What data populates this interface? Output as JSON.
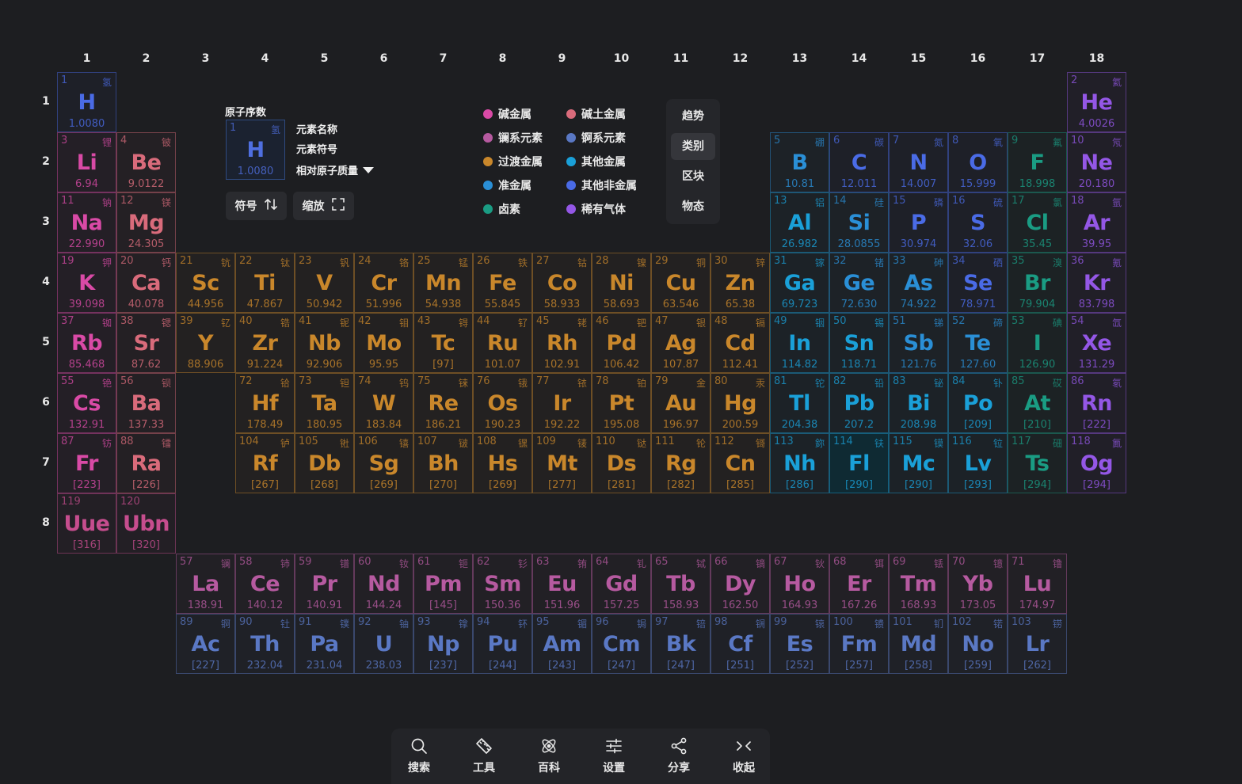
{
  "groups": [
    "1",
    "2",
    "3",
    "4",
    "5",
    "6",
    "7",
    "8",
    "9",
    "10",
    "11",
    "12",
    "13",
    "14",
    "15",
    "16",
    "17",
    "18"
  ],
  "periods": [
    "1",
    "2",
    "3",
    "4",
    "5",
    "6",
    "7",
    "8"
  ],
  "colors": {
    "alkali": "#d94aa6",
    "alkaline_earth": "#d96b7b",
    "lanthanide": "#b65aa0",
    "actinide": "#5a78c4",
    "transition": "#c9872b",
    "post_transition": "#1aa0d8",
    "metalloid": "#2a8fd6",
    "halogen": "#1a9c83",
    "nonmetal": "#4a6be6",
    "noble": "#9457e6",
    "unknown": "#c64d8e"
  },
  "key": {
    "atomic_number_label": "原子序数",
    "name_label": "元素名称",
    "symbol_label": "元素符号",
    "mass_label": "相对原子质量",
    "sample": {
      "num": "1",
      "cn": "氢",
      "sym": "H",
      "mass": "1.0080"
    }
  },
  "buttons": {
    "symbol": "符号",
    "zoom": "缩放"
  },
  "legend": [
    {
      "label": "碱金属",
      "color": "#d94aa6"
    },
    {
      "label": "碱土金属",
      "color": "#d96b7b"
    },
    {
      "label": "镧系元素",
      "color": "#b65aa0"
    },
    {
      "label": "锕系元素",
      "color": "#5a78c4"
    },
    {
      "label": "过渡金属",
      "color": "#c9872b"
    },
    {
      "label": "其他金属",
      "color": "#1aa0d8"
    },
    {
      "label": "准金属",
      "color": "#2a8fd6"
    },
    {
      "label": "其他非金属",
      "color": "#4a6be6"
    },
    {
      "label": "卤素",
      "color": "#1a9c83"
    },
    {
      "label": "稀有气体",
      "color": "#9457e6"
    }
  ],
  "modes": [
    {
      "label": "趋势",
      "active": false
    },
    {
      "label": "类别",
      "active": true
    },
    {
      "label": "区块",
      "active": false
    },
    {
      "label": "物态",
      "active": false
    }
  ],
  "toolbar": [
    {
      "label": "搜索",
      "icon": "search-icon"
    },
    {
      "label": "工具",
      "icon": "ruler-icon"
    },
    {
      "label": "百科",
      "icon": "atom-icon"
    },
    {
      "label": "设置",
      "icon": "sliders-icon"
    },
    {
      "label": "分享",
      "icon": "share-icon"
    },
    {
      "label": "收起",
      "icon": "collapse-icon"
    }
  ],
  "elements": [
    {
      "n": "1",
      "cn": "氢",
      "s": "H",
      "m": "1.0080",
      "g": 1,
      "p": 1,
      "c": "nonmetal"
    },
    {
      "n": "2",
      "cn": "氦",
      "s": "He",
      "m": "4.0026",
      "g": 18,
      "p": 1,
      "c": "noble"
    },
    {
      "n": "3",
      "cn": "锂",
      "s": "Li",
      "m": "6.94",
      "g": 1,
      "p": 2,
      "c": "alkali"
    },
    {
      "n": "4",
      "cn": "铍",
      "s": "Be",
      "m": "9.0122",
      "g": 2,
      "p": 2,
      "c": "alkaline_earth"
    },
    {
      "n": "5",
      "cn": "硼",
      "s": "B",
      "m": "10.81",
      "g": 13,
      "p": 2,
      "c": "metalloid"
    },
    {
      "n": "6",
      "cn": "碳",
      "s": "C",
      "m": "12.011",
      "g": 14,
      "p": 2,
      "c": "nonmetal"
    },
    {
      "n": "7",
      "cn": "氮",
      "s": "N",
      "m": "14.007",
      "g": 15,
      "p": 2,
      "c": "nonmetal"
    },
    {
      "n": "8",
      "cn": "氧",
      "s": "O",
      "m": "15.999",
      "g": 16,
      "p": 2,
      "c": "nonmetal"
    },
    {
      "n": "9",
      "cn": "氟",
      "s": "F",
      "m": "18.998",
      "g": 17,
      "p": 2,
      "c": "halogen"
    },
    {
      "n": "10",
      "cn": "氖",
      "s": "Ne",
      "m": "20.180",
      "g": 18,
      "p": 2,
      "c": "noble"
    },
    {
      "n": "11",
      "cn": "钠",
      "s": "Na",
      "m": "22.990",
      "g": 1,
      "p": 3,
      "c": "alkali"
    },
    {
      "n": "12",
      "cn": "镁",
      "s": "Mg",
      "m": "24.305",
      "g": 2,
      "p": 3,
      "c": "alkaline_earth"
    },
    {
      "n": "13",
      "cn": "铝",
      "s": "Al",
      "m": "26.982",
      "g": 13,
      "p": 3,
      "c": "post_transition"
    },
    {
      "n": "14",
      "cn": "硅",
      "s": "Si",
      "m": "28.0855",
      "g": 14,
      "p": 3,
      "c": "metalloid"
    },
    {
      "n": "15",
      "cn": "磷",
      "s": "P",
      "m": "30.974",
      "g": 15,
      "p": 3,
      "c": "nonmetal"
    },
    {
      "n": "16",
      "cn": "硫",
      "s": "S",
      "m": "32.06",
      "g": 16,
      "p": 3,
      "c": "nonmetal"
    },
    {
      "n": "17",
      "cn": "氯",
      "s": "Cl",
      "m": "35.45",
      "g": 17,
      "p": 3,
      "c": "halogen"
    },
    {
      "n": "18",
      "cn": "氩",
      "s": "Ar",
      "m": "39.95",
      "g": 18,
      "p": 3,
      "c": "noble"
    },
    {
      "n": "19",
      "cn": "钾",
      "s": "K",
      "m": "39.098",
      "g": 1,
      "p": 4,
      "c": "alkali"
    },
    {
      "n": "20",
      "cn": "钙",
      "s": "Ca",
      "m": "40.078",
      "g": 2,
      "p": 4,
      "c": "alkaline_earth"
    },
    {
      "n": "21",
      "cn": "钪",
      "s": "Sc",
      "m": "44.956",
      "g": 3,
      "p": 4,
      "c": "transition"
    },
    {
      "n": "22",
      "cn": "钛",
      "s": "Ti",
      "m": "47.867",
      "g": 4,
      "p": 4,
      "c": "transition"
    },
    {
      "n": "23",
      "cn": "钒",
      "s": "V",
      "m": "50.942",
      "g": 5,
      "p": 4,
      "c": "transition"
    },
    {
      "n": "24",
      "cn": "铬",
      "s": "Cr",
      "m": "51.996",
      "g": 6,
      "p": 4,
      "c": "transition"
    },
    {
      "n": "25",
      "cn": "锰",
      "s": "Mn",
      "m": "54.938",
      "g": 7,
      "p": 4,
      "c": "transition"
    },
    {
      "n": "26",
      "cn": "铁",
      "s": "Fe",
      "m": "55.845",
      "g": 8,
      "p": 4,
      "c": "transition"
    },
    {
      "n": "27",
      "cn": "钴",
      "s": "Co",
      "m": "58.933",
      "g": 9,
      "p": 4,
      "c": "transition"
    },
    {
      "n": "28",
      "cn": "镍",
      "s": "Ni",
      "m": "58.693",
      "g": 10,
      "p": 4,
      "c": "transition"
    },
    {
      "n": "29",
      "cn": "铜",
      "s": "Cu",
      "m": "63.546",
      "g": 11,
      "p": 4,
      "c": "transition"
    },
    {
      "n": "30",
      "cn": "锌",
      "s": "Zn",
      "m": "65.38",
      "g": 12,
      "p": 4,
      "c": "transition"
    },
    {
      "n": "31",
      "cn": "镓",
      "s": "Ga",
      "m": "69.723",
      "g": 13,
      "p": 4,
      "c": "post_transition"
    },
    {
      "n": "32",
      "cn": "锗",
      "s": "Ge",
      "m": "72.630",
      "g": 14,
      "p": 4,
      "c": "metalloid"
    },
    {
      "n": "33",
      "cn": "砷",
      "s": "As",
      "m": "74.922",
      "g": 15,
      "p": 4,
      "c": "metalloid"
    },
    {
      "n": "34",
      "cn": "硒",
      "s": "Se",
      "m": "78.971",
      "g": 16,
      "p": 4,
      "c": "nonmetal"
    },
    {
      "n": "35",
      "cn": "溴",
      "s": "Br",
      "m": "79.904",
      "g": 17,
      "p": 4,
      "c": "halogen"
    },
    {
      "n": "36",
      "cn": "氪",
      "s": "Kr",
      "m": "83.798",
      "g": 18,
      "p": 4,
      "c": "noble"
    },
    {
      "n": "37",
      "cn": "铷",
      "s": "Rb",
      "m": "85.468",
      "g": 1,
      "p": 5,
      "c": "alkali"
    },
    {
      "n": "38",
      "cn": "锶",
      "s": "Sr",
      "m": "87.62",
      "g": 2,
      "p": 5,
      "c": "alkaline_earth"
    },
    {
      "n": "39",
      "cn": "钇",
      "s": "Y",
      "m": "88.906",
      "g": 3,
      "p": 5,
      "c": "transition"
    },
    {
      "n": "40",
      "cn": "锆",
      "s": "Zr",
      "m": "91.224",
      "g": 4,
      "p": 5,
      "c": "transition"
    },
    {
      "n": "41",
      "cn": "铌",
      "s": "Nb",
      "m": "92.906",
      "g": 5,
      "p": 5,
      "c": "transition"
    },
    {
      "n": "42",
      "cn": "钼",
      "s": "Mo",
      "m": "95.95",
      "g": 6,
      "p": 5,
      "c": "transition"
    },
    {
      "n": "43",
      "cn": "锝",
      "s": "Tc",
      "m": "[97]",
      "g": 7,
      "p": 5,
      "c": "transition"
    },
    {
      "n": "44",
      "cn": "钌",
      "s": "Ru",
      "m": "101.07",
      "g": 8,
      "p": 5,
      "c": "transition"
    },
    {
      "n": "45",
      "cn": "铑",
      "s": "Rh",
      "m": "102.91",
      "g": 9,
      "p": 5,
      "c": "transition"
    },
    {
      "n": "46",
      "cn": "钯",
      "s": "Pd",
      "m": "106.42",
      "g": 10,
      "p": 5,
      "c": "transition"
    },
    {
      "n": "47",
      "cn": "银",
      "s": "Ag",
      "m": "107.87",
      "g": 11,
      "p": 5,
      "c": "transition"
    },
    {
      "n": "48",
      "cn": "镉",
      "s": "Cd",
      "m": "112.41",
      "g": 12,
      "p": 5,
      "c": "transition"
    },
    {
      "n": "49",
      "cn": "铟",
      "s": "In",
      "m": "114.82",
      "g": 13,
      "p": 5,
      "c": "post_transition"
    },
    {
      "n": "50",
      "cn": "锡",
      "s": "Sn",
      "m": "118.71",
      "g": 14,
      "p": 5,
      "c": "post_transition"
    },
    {
      "n": "51",
      "cn": "锑",
      "s": "Sb",
      "m": "121.76",
      "g": 15,
      "p": 5,
      "c": "metalloid"
    },
    {
      "n": "52",
      "cn": "碲",
      "s": "Te",
      "m": "127.60",
      "g": 16,
      "p": 5,
      "c": "metalloid"
    },
    {
      "n": "53",
      "cn": "碘",
      "s": "I",
      "m": "126.90",
      "g": 17,
      "p": 5,
      "c": "halogen"
    },
    {
      "n": "54",
      "cn": "氙",
      "s": "Xe",
      "m": "131.29",
      "g": 18,
      "p": 5,
      "c": "noble"
    },
    {
      "n": "55",
      "cn": "铯",
      "s": "Cs",
      "m": "132.91",
      "g": 1,
      "p": 6,
      "c": "alkali"
    },
    {
      "n": "56",
      "cn": "钡",
      "s": "Ba",
      "m": "137.33",
      "g": 2,
      "p": 6,
      "c": "alkaline_earth"
    },
    {
      "n": "72",
      "cn": "铪",
      "s": "Hf",
      "m": "178.49",
      "g": 4,
      "p": 6,
      "c": "transition"
    },
    {
      "n": "73",
      "cn": "钽",
      "s": "Ta",
      "m": "180.95",
      "g": 5,
      "p": 6,
      "c": "transition"
    },
    {
      "n": "74",
      "cn": "钨",
      "s": "W",
      "m": "183.84",
      "g": 6,
      "p": 6,
      "c": "transition"
    },
    {
      "n": "75",
      "cn": "铼",
      "s": "Re",
      "m": "186.21",
      "g": 7,
      "p": 6,
      "c": "transition"
    },
    {
      "n": "76",
      "cn": "锇",
      "s": "Os",
      "m": "190.23",
      "g": 8,
      "p": 6,
      "c": "transition"
    },
    {
      "n": "77",
      "cn": "铱",
      "s": "Ir",
      "m": "192.22",
      "g": 9,
      "p": 6,
      "c": "transition"
    },
    {
      "n": "78",
      "cn": "铂",
      "s": "Pt",
      "m": "195.08",
      "g": 10,
      "p": 6,
      "c": "transition"
    },
    {
      "n": "79",
      "cn": "金",
      "s": "Au",
      "m": "196.97",
      "g": 11,
      "p": 6,
      "c": "transition"
    },
    {
      "n": "80",
      "cn": "汞",
      "s": "Hg",
      "m": "200.59",
      "g": 12,
      "p": 6,
      "c": "transition"
    },
    {
      "n": "81",
      "cn": "铊",
      "s": "Tl",
      "m": "204.38",
      "g": 13,
      "p": 6,
      "c": "post_transition"
    },
    {
      "n": "82",
      "cn": "铅",
      "s": "Pb",
      "m": "207.2",
      "g": 14,
      "p": 6,
      "c": "post_transition"
    },
    {
      "n": "83",
      "cn": "铋",
      "s": "Bi",
      "m": "208.98",
      "g": 15,
      "p": 6,
      "c": "post_transition"
    },
    {
      "n": "84",
      "cn": "钋",
      "s": "Po",
      "m": "[209]",
      "g": 16,
      "p": 6,
      "c": "post_transition"
    },
    {
      "n": "85",
      "cn": "砹",
      "s": "At",
      "m": "[210]",
      "g": 17,
      "p": 6,
      "c": "halogen"
    },
    {
      "n": "86",
      "cn": "氡",
      "s": "Rn",
      "m": "[222]",
      "g": 18,
      "p": 6,
      "c": "noble"
    },
    {
      "n": "87",
      "cn": "钫",
      "s": "Fr",
      "m": "[223]",
      "g": 1,
      "p": 7,
      "c": "alkali"
    },
    {
      "n": "88",
      "cn": "镭",
      "s": "Ra",
      "m": "[226]",
      "g": 2,
      "p": 7,
      "c": "alkaline_earth"
    },
    {
      "n": "104",
      "cn": "𬬻",
      "s": "Rf",
      "m": "[267]",
      "g": 4,
      "p": 7,
      "c": "transition"
    },
    {
      "n": "105",
      "cn": "𬭊",
      "s": "Db",
      "m": "[268]",
      "g": 5,
      "p": 7,
      "c": "transition"
    },
    {
      "n": "106",
      "cn": "𬭳",
      "s": "Sg",
      "m": "[269]",
      "g": 6,
      "p": 7,
      "c": "transition"
    },
    {
      "n": "107",
      "cn": "𬭛",
      "s": "Bh",
      "m": "[270]",
      "g": 7,
      "p": 7,
      "c": "transition"
    },
    {
      "n": "108",
      "cn": "𬭶",
      "s": "Hs",
      "m": "[269]",
      "g": 8,
      "p": 7,
      "c": "transition"
    },
    {
      "n": "109",
      "cn": "鿏",
      "s": "Mt",
      "m": "[277]",
      "g": 9,
      "p": 7,
      "c": "transition"
    },
    {
      "n": "110",
      "cn": "𫟼",
      "s": "Ds",
      "m": "[281]",
      "g": 10,
      "p": 7,
      "c": "transition"
    },
    {
      "n": "111",
      "cn": "𬬭",
      "s": "Rg",
      "m": "[282]",
      "g": 11,
      "p": 7,
      "c": "transition"
    },
    {
      "n": "112",
      "cn": "鿔",
      "s": "Cn",
      "m": "[285]",
      "g": 12,
      "p": 7,
      "c": "transition"
    },
    {
      "n": "113",
      "cn": "鉨",
      "s": "Nh",
      "m": "[286]",
      "g": 13,
      "p": 7,
      "c": "post_transition"
    },
    {
      "n": "114",
      "cn": "𫓧",
      "s": "Fl",
      "m": "[290]",
      "g": 14,
      "p": 7,
      "c": "post_transition",
      "hl": true
    },
    {
      "n": "115",
      "cn": "镆",
      "s": "Mc",
      "m": "[290]",
      "g": 15,
      "p": 7,
      "c": "post_transition"
    },
    {
      "n": "116",
      "cn": "𫟷",
      "s": "Lv",
      "m": "[293]",
      "g": 16,
      "p": 7,
      "c": "post_transition"
    },
    {
      "n": "117",
      "cn": "鿬",
      "s": "Ts",
      "m": "[294]",
      "g": 17,
      "p": 7,
      "c": "halogen"
    },
    {
      "n": "118",
      "cn": "鿫",
      "s": "Og",
      "m": "[294]",
      "g": 18,
      "p": 7,
      "c": "noble"
    },
    {
      "n": "119",
      "cn": "",
      "s": "Uue",
      "m": "[316]",
      "g": 1,
      "p": 8,
      "c": "unknown"
    },
    {
      "n": "120",
      "cn": "",
      "s": "Ubn",
      "m": "[320]",
      "g": 2,
      "p": 8,
      "c": "unknown"
    },
    {
      "n": "57",
      "cn": "镧",
      "s": "La",
      "m": "138.91",
      "g": 3,
      "p": 9,
      "c": "lanthanide"
    },
    {
      "n": "58",
      "cn": "铈",
      "s": "Ce",
      "m": "140.12",
      "g": 4,
      "p": 9,
      "c": "lanthanide"
    },
    {
      "n": "59",
      "cn": "镨",
      "s": "Pr",
      "m": "140.91",
      "g": 5,
      "p": 9,
      "c": "lanthanide"
    },
    {
      "n": "60",
      "cn": "钕",
      "s": "Nd",
      "m": "144.24",
      "g": 6,
      "p": 9,
      "c": "lanthanide"
    },
    {
      "n": "61",
      "cn": "钷",
      "s": "Pm",
      "m": "[145]",
      "g": 7,
      "p": 9,
      "c": "lanthanide"
    },
    {
      "n": "62",
      "cn": "钐",
      "s": "Sm",
      "m": "150.36",
      "g": 8,
      "p": 9,
      "c": "lanthanide"
    },
    {
      "n": "63",
      "cn": "铕",
      "s": "Eu",
      "m": "151.96",
      "g": 9,
      "p": 9,
      "c": "lanthanide"
    },
    {
      "n": "64",
      "cn": "钆",
      "s": "Gd",
      "m": "157.25",
      "g": 10,
      "p": 9,
      "c": "lanthanide"
    },
    {
      "n": "65",
      "cn": "铽",
      "s": "Tb",
      "m": "158.93",
      "g": 11,
      "p": 9,
      "c": "lanthanide"
    },
    {
      "n": "66",
      "cn": "镝",
      "s": "Dy",
      "m": "162.50",
      "g": 12,
      "p": 9,
      "c": "lanthanide"
    },
    {
      "n": "67",
      "cn": "钬",
      "s": "Ho",
      "m": "164.93",
      "g": 13,
      "p": 9,
      "c": "lanthanide"
    },
    {
      "n": "68",
      "cn": "铒",
      "s": "Er",
      "m": "167.26",
      "g": 14,
      "p": 9,
      "c": "lanthanide"
    },
    {
      "n": "69",
      "cn": "铥",
      "s": "Tm",
      "m": "168.93",
      "g": 15,
      "p": 9,
      "c": "lanthanide"
    },
    {
      "n": "70",
      "cn": "镱",
      "s": "Yb",
      "m": "173.05",
      "g": 16,
      "p": 9,
      "c": "lanthanide"
    },
    {
      "n": "71",
      "cn": "镥",
      "s": "Lu",
      "m": "174.97",
      "g": 17,
      "p": 9,
      "c": "lanthanide"
    },
    {
      "n": "89",
      "cn": "锕",
      "s": "Ac",
      "m": "[227]",
      "g": 3,
      "p": 10,
      "c": "actinide"
    },
    {
      "n": "90",
      "cn": "钍",
      "s": "Th",
      "m": "232.04",
      "g": 4,
      "p": 10,
      "c": "actinide"
    },
    {
      "n": "91",
      "cn": "镤",
      "s": "Pa",
      "m": "231.04",
      "g": 5,
      "p": 10,
      "c": "actinide"
    },
    {
      "n": "92",
      "cn": "铀",
      "s": "U",
      "m": "238.03",
      "g": 6,
      "p": 10,
      "c": "actinide"
    },
    {
      "n": "93",
      "cn": "镎",
      "s": "Np",
      "m": "[237]",
      "g": 7,
      "p": 10,
      "c": "actinide"
    },
    {
      "n": "94",
      "cn": "钚",
      "s": "Pu",
      "m": "[244]",
      "g": 8,
      "p": 10,
      "c": "actinide"
    },
    {
      "n": "95",
      "cn": "镅",
      "s": "Am",
      "m": "[243]",
      "g": 9,
      "p": 10,
      "c": "actinide"
    },
    {
      "n": "96",
      "cn": "锔",
      "s": "Cm",
      "m": "[247]",
      "g": 10,
      "p": 10,
      "c": "actinide"
    },
    {
      "n": "97",
      "cn": "锫",
      "s": "Bk",
      "m": "[247]",
      "g": 11,
      "p": 10,
      "c": "actinide"
    },
    {
      "n": "98",
      "cn": "锎",
      "s": "Cf",
      "m": "[251]",
      "g": 12,
      "p": 10,
      "c": "actinide"
    },
    {
      "n": "99",
      "cn": "锿",
      "s": "Es",
      "m": "[252]",
      "g": 13,
      "p": 10,
      "c": "actinide"
    },
    {
      "n": "100",
      "cn": "镄",
      "s": "Fm",
      "m": "[257]",
      "g": 14,
      "p": 10,
      "c": "actinide"
    },
    {
      "n": "101",
      "cn": "钔",
      "s": "Md",
      "m": "[258]",
      "g": 15,
      "p": 10,
      "c": "actinide"
    },
    {
      "n": "102",
      "cn": "锘",
      "s": "No",
      "m": "[259]",
      "g": 16,
      "p": 10,
      "c": "actinide"
    },
    {
      "n": "103",
      "cn": "铹",
      "s": "Lr",
      "m": "[262]",
      "g": 17,
      "p": 10,
      "c": "actinide"
    }
  ]
}
